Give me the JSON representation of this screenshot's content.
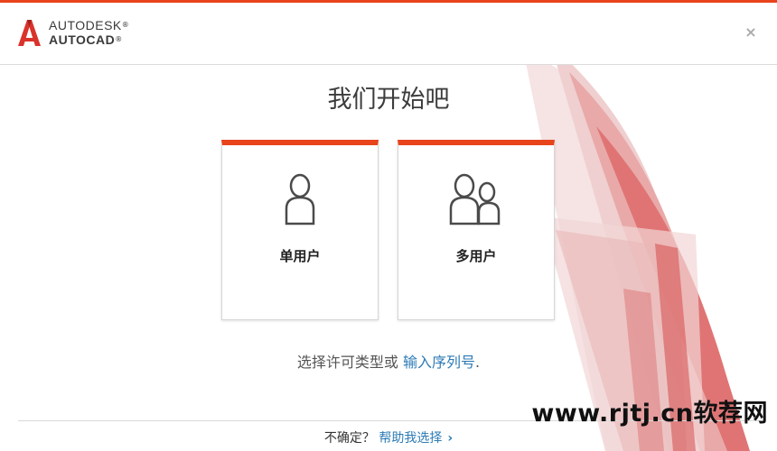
{
  "brand": {
    "line1": "AUTODESK",
    "line1_mark": "®",
    "line2": "AUTOCAD",
    "line2_mark": "®",
    "accent_color": "#e8431b"
  },
  "window": {
    "close_icon": "close-icon"
  },
  "page": {
    "title": "我们开始吧"
  },
  "options": [
    {
      "label": "单用户",
      "icon": "single-user-icon"
    },
    {
      "label": "多用户",
      "icon": "multi-user-icon"
    }
  ],
  "license": {
    "prefix": "选择许可类型或",
    "link_text": "输入序列号",
    "suffix": "."
  },
  "footer": {
    "question": "不确定？",
    "link_text": "帮助我选择",
    "link_color": "#2d7bb6"
  },
  "watermark": {
    "text": "www.rjtj.cn软荐网"
  }
}
